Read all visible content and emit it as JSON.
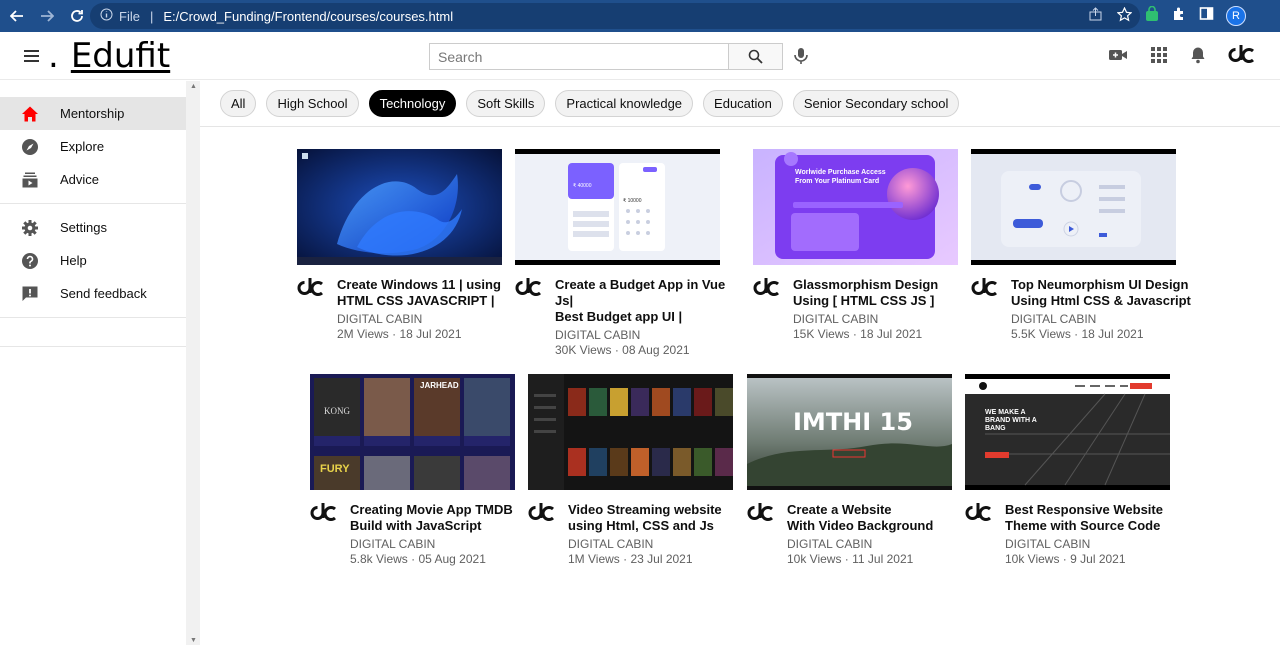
{
  "browser": {
    "scheme": "File",
    "url": "E:/Crowd_Funding/Frontend/courses/courses.html",
    "profile_initial": "R"
  },
  "app": {
    "logo_text": "Edufit",
    "logo_dot": ".",
    "search_placeholder": "Search"
  },
  "sidebar": {
    "items": [
      {
        "label": "Mentorship",
        "icon": "home-icon",
        "active": true
      },
      {
        "label": "Explore",
        "icon": "compass-icon"
      },
      {
        "label": "Advice",
        "icon": "subscriptions-icon"
      },
      {
        "label": "Settings",
        "icon": "gear-icon"
      },
      {
        "label": "Help",
        "icon": "help-icon"
      },
      {
        "label": "Send feedback",
        "icon": "feedback-icon"
      }
    ]
  },
  "chips": [
    "All",
    "High School",
    "Technology",
    "Soft Skills",
    "Practical knowledge",
    "Education",
    "Senior Secondary school"
  ],
  "active_chip": "Technology",
  "videos": [
    {
      "title": "Create Windows 11 | using\nHTML CSS JAVASCRIPT |",
      "channel": "DIGITAL CABIN",
      "stats": "2M Views · 18 Jul 2021"
    },
    {
      "title": "Create a Budget App in Vue Js|\nBest Budget app UI |",
      "channel": "DIGITAL CABIN",
      "stats": "30K Views · 08 Aug 2021"
    },
    {
      "title": "Glassmorphism Design\nUsing [ HTML CSS JS ]",
      "channel": "DIGITAL CABIN",
      "stats": "15K Views · 18 Jul 2021"
    },
    {
      "title": "Top Neumorphism UI Design\nUsing Html CSS & Javascript",
      "channel": "DIGITAL CABIN",
      "stats": "5.5K Views · 18 Jul 2021"
    },
    {
      "title": "Creating Movie App TMDB\nBuild with JavaScript",
      "channel": "DIGITAL CABIN",
      "stats": "5.8k Views · 05 Aug 2021"
    },
    {
      "title": "Video Streaming website\nusing Html, CSS and Js",
      "channel": "DIGITAL CABIN",
      "stats": "1M Views · 23 Jul 2021"
    },
    {
      "title": "Create a Website\nWith Video Background",
      "channel": "DIGITAL CABIN",
      "stats": "10k Views · 11 Jul 2021"
    },
    {
      "title": "Best Responsive Website\nTheme with Source Code",
      "channel": "DIGITAL CABIN",
      "stats": "10k Views · 9 Jul 2021"
    }
  ],
  "thumb_text": {
    "glass_heading": "Worlwide Purchase Access\nFrom Your Platinum Card",
    "imthi": "IMTHI 15",
    "theme_heading": "WE MAKE A\nBRAND WITH A\nBANG",
    "budget_amount": "₹ 40000",
    "budget_amount2": "₹ 10000",
    "movie_kong": "KONG",
    "movie_jarhead": "JARHEAD",
    "movie_fury": "FURY"
  },
  "colors": {
    "chrome": "#1f4f8c",
    "accent_red": "#ff0000",
    "active_chip": "#000000"
  }
}
